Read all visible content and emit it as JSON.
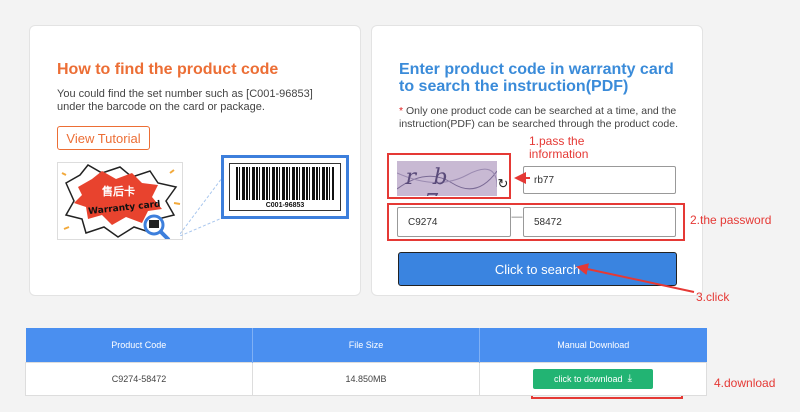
{
  "left": {
    "title": "How to find the product code",
    "description": "You could find the set number such as [C001-96853] under the barcode on the card or package.",
    "tutorial_button": "View Tutorial",
    "card_chinese": "售后卡",
    "card_english": "Warranty card",
    "barcode_number": "C001-96853"
  },
  "right": {
    "title": "Enter product code in warranty card to search the instruction(PDF)",
    "note_star": "*",
    "note": " Only one product code can be searched at a time, and the instruction(PDF) can be searched through the product code.",
    "captcha_text": "r b >7",
    "captcha_value": "rb77",
    "code_part1": "C9274",
    "code_separator": "—",
    "code_part2": "58472",
    "search_button": "Click to search"
  },
  "annotations": {
    "step1": "1.pass the\ninformation",
    "step2": "2.the password",
    "step3": "3.click",
    "step4": "4.download"
  },
  "table": {
    "headers": [
      "Product Code",
      "File Size",
      "Manual Download"
    ],
    "rows": [
      {
        "product_code": "C9274-58472",
        "file_size": "14.850MB",
        "download_label": "click to download"
      }
    ]
  },
  "colors": {
    "orange_accent": "#ec6e35",
    "blue_title": "#3a8bd9",
    "search_button": "#3a84e0",
    "table_header": "#4a8ff0",
    "download_button": "#22b473",
    "annotation_red": "#e53935"
  },
  "icons": {
    "refresh": "refresh-icon",
    "download": "download-icon",
    "magnifier": "magnifier-icon"
  }
}
